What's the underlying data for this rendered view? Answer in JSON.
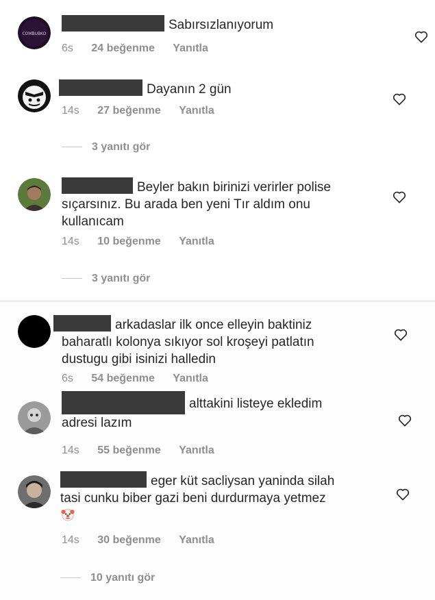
{
  "comments": [
    {
      "text": "Sabırsızlanıyorum",
      "time": "6s",
      "likes": "24 beğenme",
      "reply": "Yanıtla",
      "avatar_text": "COMBUBKO"
    },
    {
      "text": "Dayanın 2 gün",
      "time": "14s",
      "likes": "27 beğenme",
      "reply": "Yanıtla",
      "view_replies": "3 yanıtı gör"
    },
    {
      "text_line1": "Beyler bakın birinizi verirler polise",
      "text_line2": "sıçarsınız. Bu arada ben yeni Tır aldım onu",
      "text_line3": "kullanıcam",
      "time": "14s",
      "likes": "10 beğenme",
      "reply": "Yanıtla",
      "view_replies": "3 yanıtı gör"
    },
    {
      "text_line1": "arkadaslar ilk once elleyin baktiniz",
      "text_line2": "baharatlı kolonya sıkıyor sol kroşeyi patlatın",
      "text_line3": "dustugu gibi isinizi halledin",
      "time": "6s",
      "likes": "54 beğenme",
      "reply": "Yanıtla"
    },
    {
      "text_line1": "alttakini listeye ekledim",
      "text_line2": "adresi lazım",
      "time": "14s",
      "likes": "55 beğenme",
      "reply": "Yanıtla"
    },
    {
      "text_line1": "eger küt sacliysan yaninda silah",
      "text_line2": "tasi cunku biber gazi beni durdurmaya yetmez",
      "emoji": "clown-face-emoji",
      "time": "14s",
      "likes": "30 beğenme",
      "reply": "Yanıtla",
      "view_replies": "10 yanıtı gör"
    }
  ],
  "icons": {
    "like": "heart-outline-icon"
  },
  "colors": {
    "text": "#262626",
    "meta": "#8e8e8e",
    "redaction": "#3a3a3a"
  }
}
